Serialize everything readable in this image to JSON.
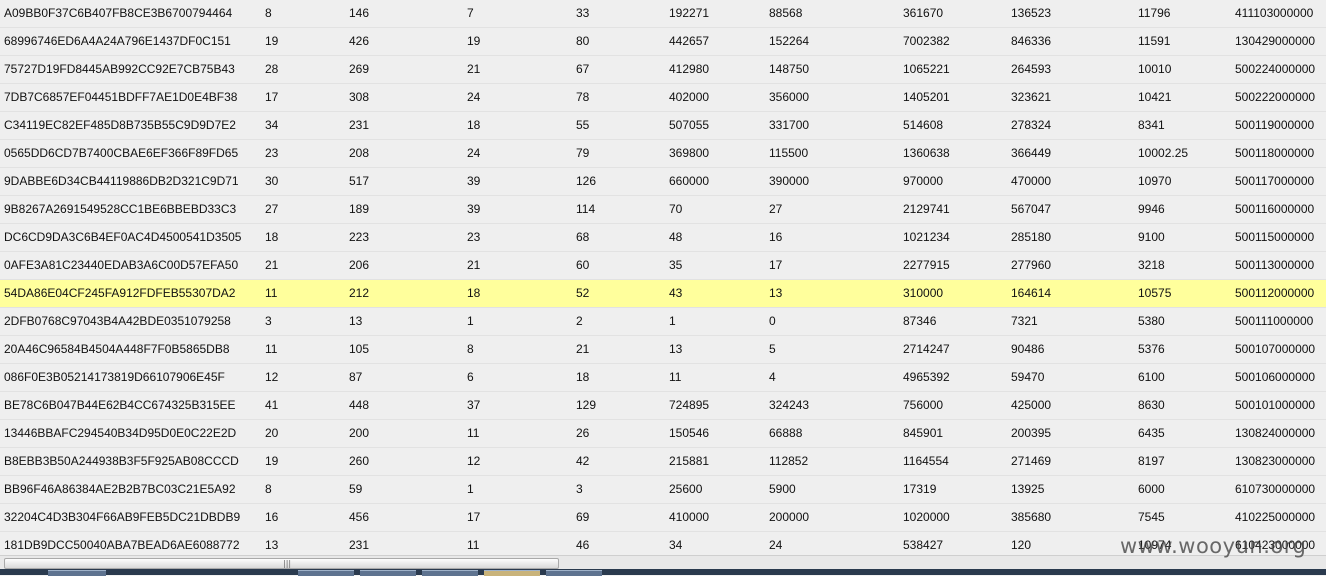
{
  "table": {
    "rows": [
      {
        "cells": [
          "A09BB0F37C6B407FB8CE3B6700794464",
          "8",
          "146",
          "7",
          "33",
          "192271",
          "88568",
          "361670",
          "136523",
          "11796",
          "411103000000"
        ]
      },
      {
        "cells": [
          "68996746ED6A4A24A796E1437DF0C151",
          "19",
          "426",
          "19",
          "80",
          "442657",
          "152264",
          "7002382",
          "846336",
          "11591",
          "130429000000"
        ]
      },
      {
        "cells": [
          "75727D19FD8445AB992CC92E7CB75B43",
          "28",
          "269",
          "21",
          "67",
          "412980",
          "148750",
          "1065221",
          "264593",
          "10010",
          "500224000000"
        ]
      },
      {
        "cells": [
          "7DB7C6857EF04451BDFF7AE1D0E4BF38",
          "17",
          "308",
          "24",
          "78",
          "402000",
          "356000",
          "1405201",
          "323621",
          "10421",
          "500222000000"
        ]
      },
      {
        "cells": [
          "C34119EC82EF485D8B735B55C9D9D7E2",
          "34",
          "231",
          "18",
          "55",
          "507055",
          "331700",
          "514608",
          "278324",
          "8341",
          "500119000000"
        ]
      },
      {
        "cells": [
          "0565DD6CD7B7400CBAE6EF366F89FD65",
          "23",
          "208",
          "24",
          "79",
          "369800",
          "115500",
          "1360638",
          "366449",
          "10002.25",
          "500118000000"
        ]
      },
      {
        "cells": [
          "9DABBE6D34CB44119886DB2D321C9D71",
          "30",
          "517",
          "39",
          "126",
          "660000",
          "390000",
          "970000",
          "470000",
          "10970",
          "500117000000"
        ]
      },
      {
        "cells": [
          "9B8267A2691549528CC1BE6BBEBD33C3",
          "27",
          "189",
          "39",
          "114",
          "70",
          "27",
          "2129741",
          "567047",
          "9946",
          "500116000000"
        ]
      },
      {
        "cells": [
          "DC6CD9DA3C6B4EF0AC4D4500541D3505",
          "18",
          "223",
          "23",
          "68",
          "48",
          "16",
          "1021234",
          "285180",
          "9100",
          "500115000000"
        ]
      },
      {
        "cells": [
          "0AFE3A81C23440EDAB3A6C00D57EFA50",
          "21",
          "206",
          "21",
          "60",
          "35",
          "17",
          "2277915",
          "277960",
          "3218",
          "500113000000"
        ]
      },
      {
        "cells": [
          "54DA86E04CF245FA912FDFEB55307DA2",
          "11",
          "212",
          "18",
          "52",
          "43",
          "13",
          "310000",
          "164614",
          "10575",
          "500112000000"
        ],
        "selected": true
      },
      {
        "cells": [
          "2DFB0768C97043B4A42BDE0351079258",
          "3",
          "13",
          "1",
          "2",
          "1",
          "0",
          "87346",
          "7321",
          "5380",
          "500111000000"
        ]
      },
      {
        "cells": [
          "20A46C96584B4504A448F7F0B5865DB8",
          "11",
          "105",
          "8",
          "21",
          "13",
          "5",
          "2714247",
          "90486",
          "5376",
          "500107000000"
        ]
      },
      {
        "cells": [
          "086F0E3B05214173819D66107906E45F",
          "12",
          "87",
          "6",
          "18",
          "11",
          "4",
          "4965392",
          "59470",
          "6100",
          "500106000000"
        ]
      },
      {
        "cells": [
          "BE78C6B047B44E62B4CC674325B315EE",
          "41",
          "448",
          "37",
          "129",
          "724895",
          "324243",
          "756000",
          "425000",
          "8630",
          "500101000000"
        ]
      },
      {
        "cells": [
          "13446BBAFC294540B34D95D0E0C22E2D",
          "20",
          "200",
          "11",
          "26",
          "150546",
          "66888",
          "845901",
          "200395",
          "6435",
          "130824000000"
        ]
      },
      {
        "cells": [
          "B8EBB3B50A244938B3F5F925AB08CCCD",
          "19",
          "260",
          "12",
          "42",
          "215881",
          "112852",
          "1164554",
          "271469",
          "8197",
          "130823000000"
        ]
      },
      {
        "cells": [
          "BB96F46A86384AE2B2B7BC03C21E5A92",
          "8",
          "59",
          "1",
          "3",
          "25600",
          "5900",
          "17319",
          "13925",
          "6000",
          "610730000000"
        ]
      },
      {
        "cells": [
          "32204C4D3B304F66AB9FEB5DC21DBDB9",
          "16",
          "456",
          "17",
          "69",
          "410000",
          "200000",
          "1020000",
          "385680",
          "7545",
          "410225000000"
        ]
      },
      {
        "cells": [
          "181DB9DCC50040ABA7BEAD6AE6088772",
          "13",
          "231",
          "11",
          "46",
          "34",
          "24",
          "538427",
          "120",
          "10974",
          "610423000000"
        ]
      }
    ]
  },
  "scrollbar": {
    "grip": "|||"
  },
  "watermark": "www.wooyun.org"
}
